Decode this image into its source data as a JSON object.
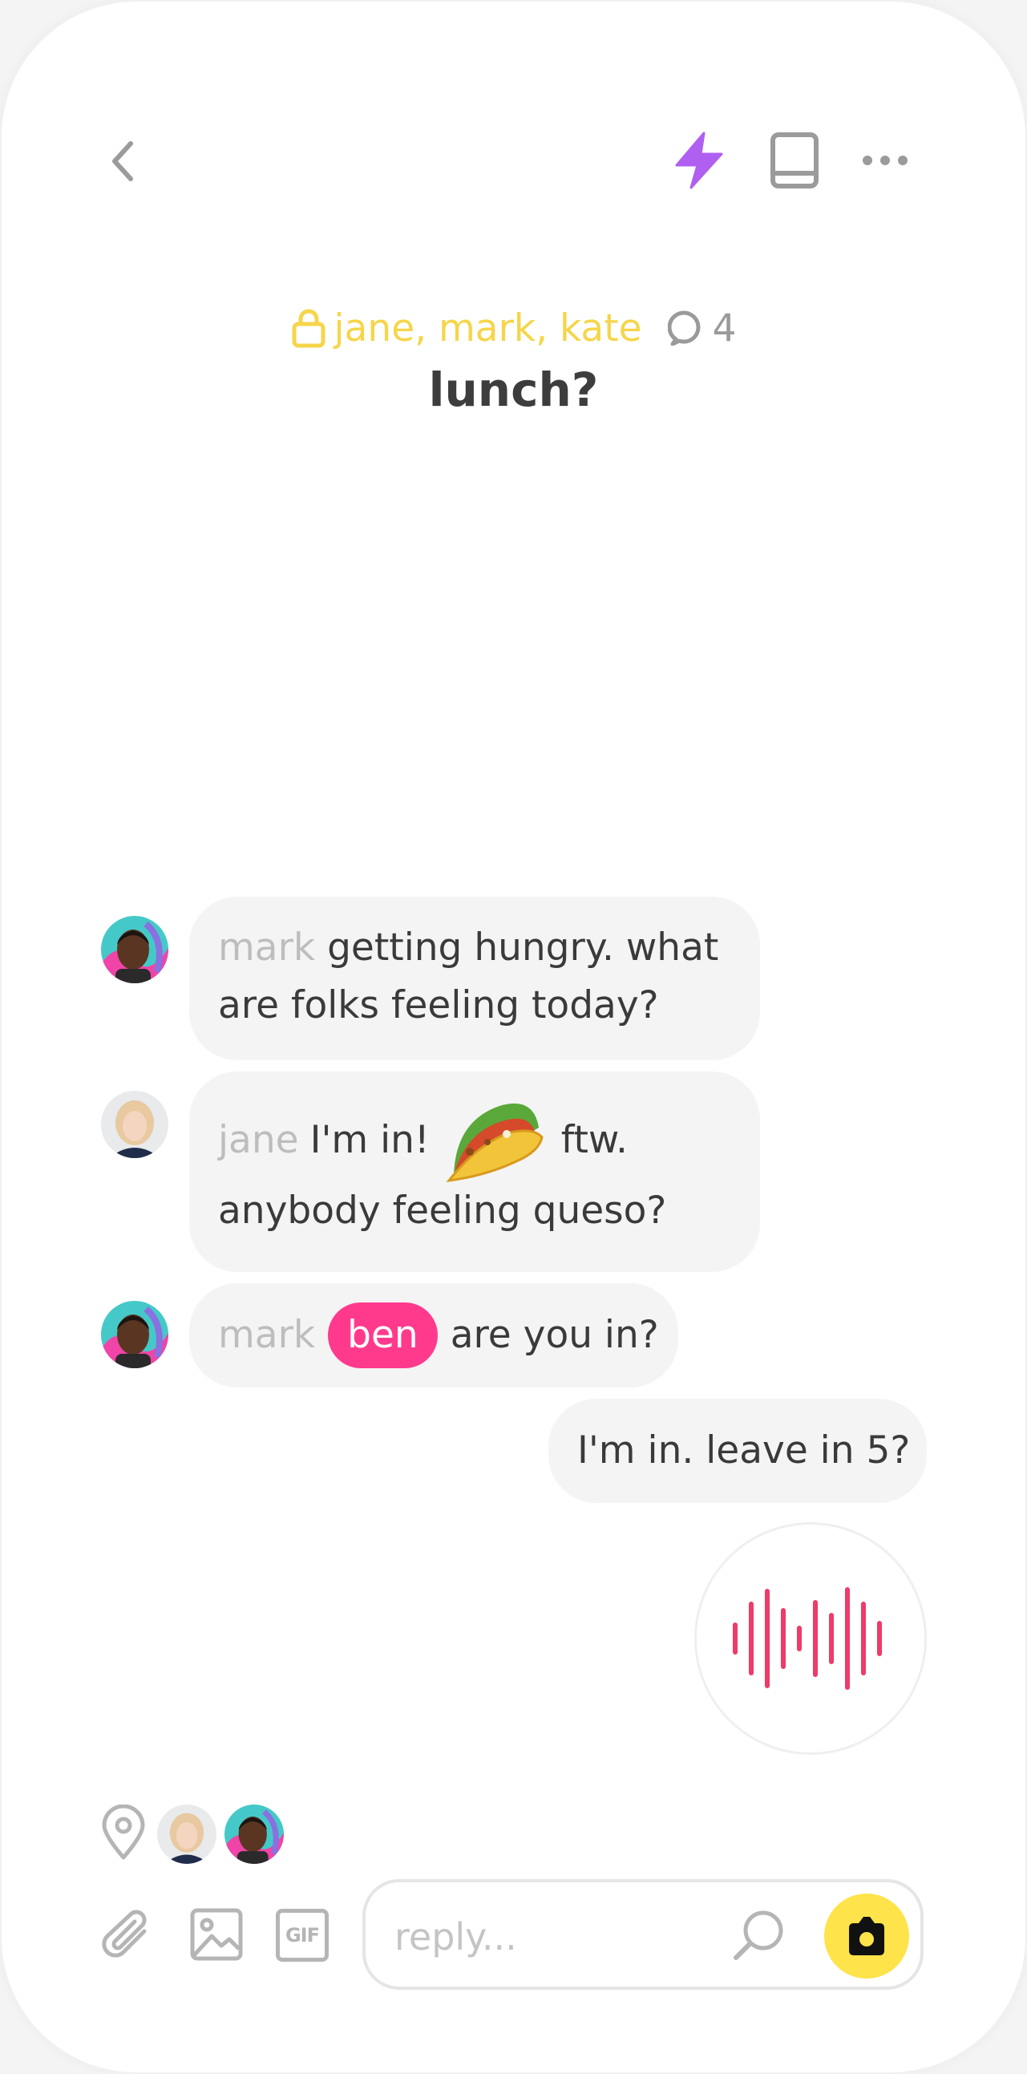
{
  "header": {
    "participants": "jane, mark, kate",
    "comment_count": "4",
    "title": "lunch?"
  },
  "messages": [
    {
      "sender": "mark",
      "line1": "getting hungry. what",
      "line2": "are folks feeling today?"
    },
    {
      "sender": "jane",
      "before_emoji": "I'm in!",
      "emoji": "taco",
      "after_emoji": "ftw.",
      "line2": "anybody feeling queso?"
    },
    {
      "sender": "mark",
      "mention": "ben",
      "text": "are you in?"
    }
  ],
  "own_message": {
    "text": "I'm in. leave in 5?"
  },
  "composer": {
    "placeholder": "reply...",
    "gif_label": "GIF"
  },
  "colors": {
    "accent_lightning": "#b060f0",
    "participants": "#f6d54a",
    "mention": "#ff3a8d",
    "voice_wave": "#f03a68",
    "send_button": "#ffe34a"
  },
  "icons": [
    "back-chevron-icon",
    "lightning-icon",
    "book-icon",
    "more-icon",
    "lock-icon",
    "comment-icon",
    "location-pin-icon",
    "paperclip-icon",
    "image-icon",
    "gif-icon",
    "search-icon",
    "camera-icon",
    "waveform-icon"
  ]
}
